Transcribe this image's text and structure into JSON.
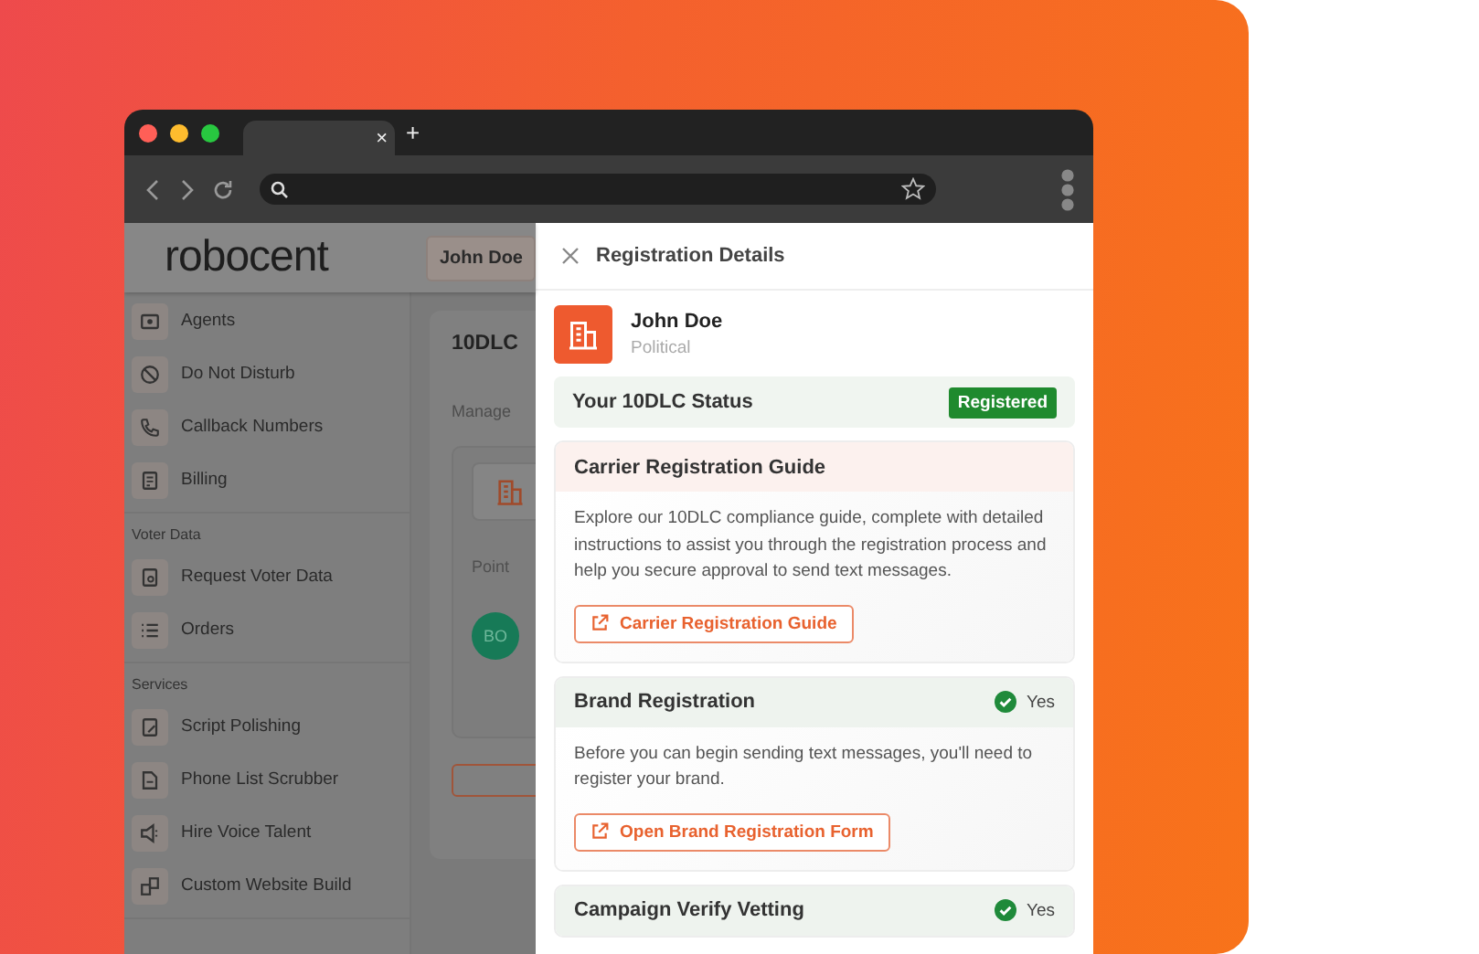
{
  "browser": {
    "tab_close": "×",
    "new_tab": "+"
  },
  "app": {
    "logo": "robocent",
    "user_chip": "John Doe",
    "sidebar": {
      "groups": [
        {
          "items": [
            {
              "label": "Agents"
            },
            {
              "label": "Do Not Disturb"
            },
            {
              "label": "Callback Numbers"
            },
            {
              "label": "Billing"
            }
          ]
        },
        {
          "heading": "Voter Data",
          "items": [
            {
              "label": "Request Voter Data"
            },
            {
              "label": "Orders"
            }
          ]
        },
        {
          "heading": "Services",
          "items": [
            {
              "label": "Script Polishing"
            },
            {
              "label": "Phone List Scrubber"
            },
            {
              "label": "Hire Voice Talent"
            },
            {
              "label": "Custom Website Build"
            }
          ]
        }
      ]
    },
    "main": {
      "title": "10DLC",
      "subtitle": "Manage",
      "column_label": "Point",
      "avatar_initials": "BO"
    }
  },
  "drawer": {
    "title": "Registration Details",
    "profile": {
      "name": "John Doe",
      "category": "Political"
    },
    "status": {
      "label": "Your 10DLC Status",
      "badge": "Registered",
      "registered": true
    },
    "sections": [
      {
        "title": "Carrier Registration Guide",
        "verified": false,
        "description": "Explore our 10DLC compliance guide, complete with detailed instructions to assist you through the registration process and help you secure approval to send text messages.",
        "button": "Carrier Registration Guide"
      },
      {
        "title": "Brand Registration",
        "verified": true,
        "status": "Yes",
        "description": "Before you can begin sending text messages, you'll need to register your brand.",
        "button": "Open Brand Registration Form"
      },
      {
        "title": "Campaign Verify Vetting",
        "verified": true,
        "status": "Yes"
      }
    ]
  }
}
